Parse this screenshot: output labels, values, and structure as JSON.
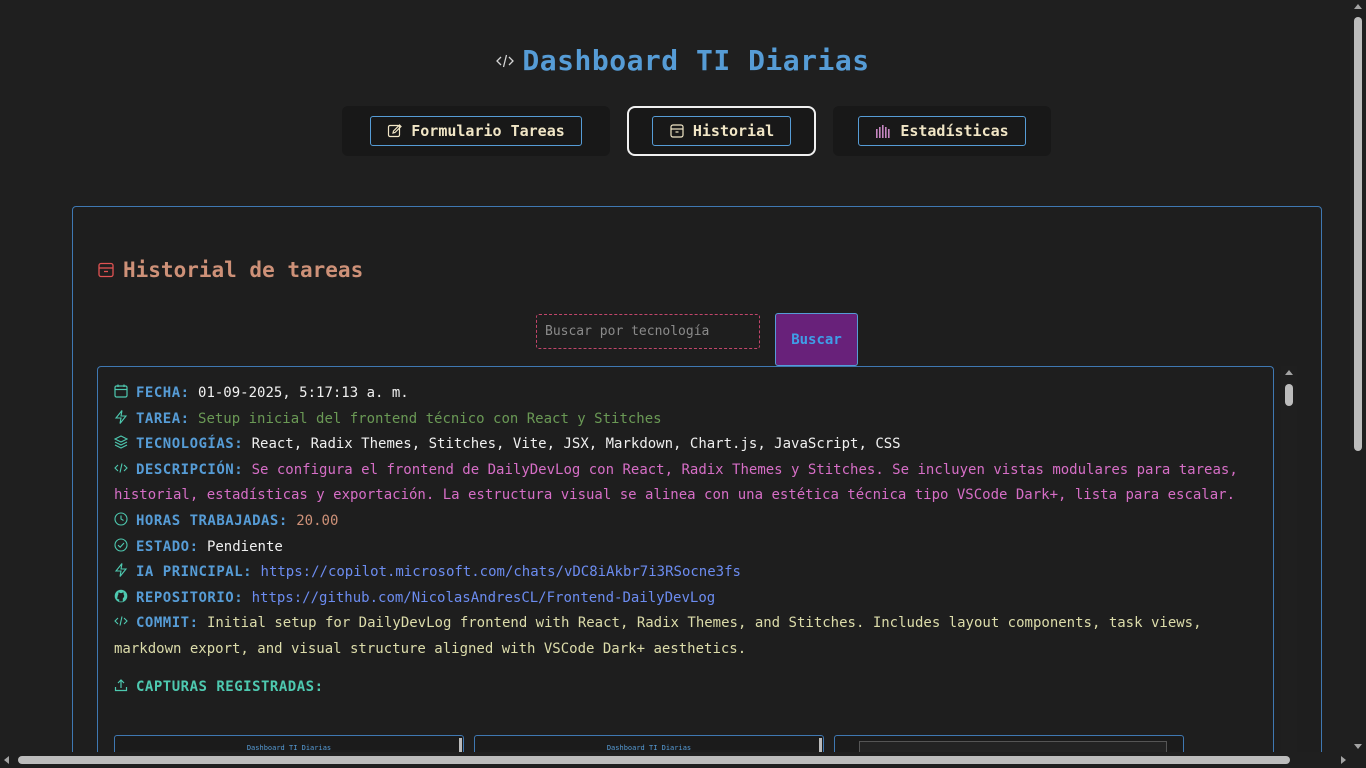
{
  "app": {
    "title": "Dashboard TI Diarias",
    "title_icon": "code-icon"
  },
  "tabs": [
    {
      "label": "Formulario Tareas",
      "icon": "edit-icon",
      "active": false
    },
    {
      "label": "Historial",
      "icon": "archive-icon",
      "active": true
    },
    {
      "label": "Estadísticas",
      "icon": "bar-chart-icon",
      "active": false
    }
  ],
  "section": {
    "title": "Historial de tareas",
    "icon": "archive-icon"
  },
  "search": {
    "placeholder": "Buscar por tecnología",
    "value": "",
    "button_label": "Buscar"
  },
  "task": {
    "fecha_label": "FECHA:",
    "fecha": "01-09-2025, 5:17:13 a. m.",
    "tarea_label": "TAREA:",
    "tarea": "Setup inicial del frontend técnico con React y Stitches",
    "tecnologias_label": "TECNOLOGÍAS:",
    "tecnologias": "React, Radix Themes, Stitches, Vite, JSX, Markdown, Chart.js, JavaScript, CSS",
    "descripcion_label": "DESCRIPCIÓN:",
    "descripcion": "Se configura el frontend de DailyDevLog con React, Radix Themes y Stitches. Se incluyen vistas modulares para tareas, historial, estadísticas y exportación. La estructura visual se alinea con una estética técnica tipo VSCode Dark+, lista para escalar.",
    "horas_label": "HORAS TRABAJADAS:",
    "horas": "20.00",
    "estado_label": "ESTADO:",
    "estado": "Pendiente",
    "ia_label": "IA PRINCIPAL:",
    "ia": "https://copilot.microsoft.com/chats/vDC8iAkbr7i3RSocne3fs",
    "repo_label": "REPOSITORIO:",
    "repo": "https://github.com/NicolasAndresCL/Frontend-DailyDevLog",
    "commit_label": "COMMIT:",
    "commit": "Initial setup for DailyDevLog frontend with React, Radix Themes, and Stitches. Includes layout components, task views, markdown export, and visual structure aligned with VSCode Dark+ aesthetics.",
    "captures_label": "CAPTURAS REGISTRADAS:",
    "captures": [
      {
        "caption": "Dashboard TI Diarias"
      },
      {
        "caption": "Dashboard TI Diarias"
      },
      {
        "caption": ""
      }
    ]
  },
  "colors": {
    "background": "#1f1f1f",
    "accent_blue": "#569cd6",
    "accent_orange": "#ce9178",
    "accent_green": "#6a9955",
    "accent_pink": "#d66ec6",
    "accent_teal": "#4ec9b0",
    "button_purple": "#68217a"
  }
}
